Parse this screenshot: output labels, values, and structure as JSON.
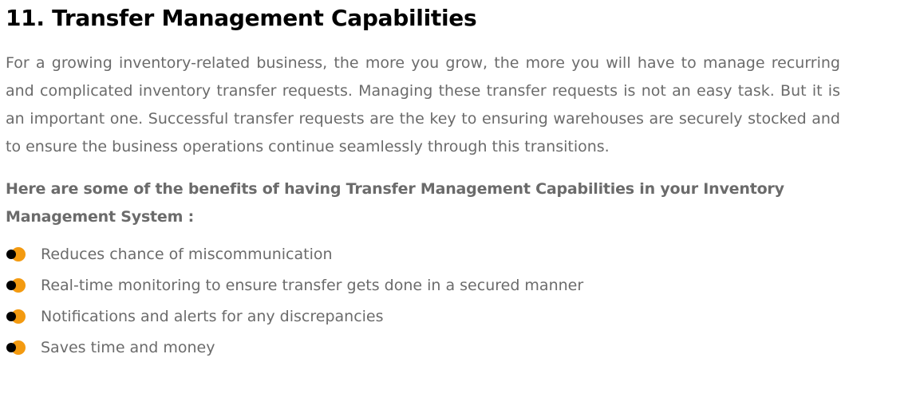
{
  "article": {
    "title": "11. Transfer Management Capabilities",
    "intro": "For a growing inventory-related business, the more you grow, the more you will have to manage recurring and complicated inventory transfer requests. Managing these transfer requests is not an easy task. But it is an important one. Successful transfer requests are the key to ensuring warehouses are securely stocked and to ensure the business operations continue seamlessly through this transitions.",
    "lead": "Here are some of the benefits of having Transfer Management Capabilities in your Inventory Management System :",
    "benefits": [
      "Reduces chance of miscommunication",
      "Real-time monitoring to ensure transfer gets done in a secured manner",
      "Notifications and alerts for any discrepancies",
      "Saves time and money"
    ]
  },
  "colors": {
    "title": "#000000",
    "body_text": "#6b6b6b",
    "bullet_accent": "#f39a10",
    "bullet_dot": "#000000"
  },
  "icons": {
    "bullet": "dual-circle-bullet-icon"
  }
}
